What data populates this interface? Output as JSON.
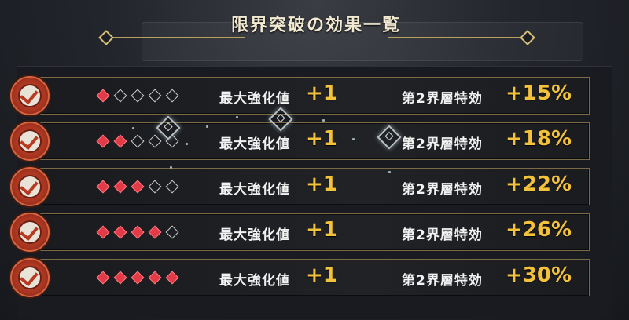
{
  "title": "限界突破の効果一覧",
  "rows": [
    {
      "filled": 1,
      "label1": "最大強化値",
      "val1": "+1",
      "label2": "第2界層特効",
      "val2": "+15%"
    },
    {
      "filled": 2,
      "label1": "最大強化値",
      "val1": "+1",
      "label2": "第2界層特効",
      "val2": "+18%"
    },
    {
      "filled": 3,
      "label1": "最大強化値",
      "val1": "+1",
      "label2": "第2界層特効",
      "val2": "+22%"
    },
    {
      "filled": 4,
      "label1": "最大強化値",
      "val1": "+1",
      "label2": "第2界層特効",
      "val2": "+26%"
    },
    {
      "filled": 5,
      "label1": "最大強化値",
      "val1": "+1",
      "label2": "第2界層特効",
      "val2": "+30%"
    }
  ],
  "icons": {
    "seal": "check-seal-icon",
    "filled": "red-diamond-icon",
    "empty": "outline-diamond-icon"
  },
  "colors": {
    "accent": "#f4c23a",
    "seal": "#b63a22",
    "diamond_on": "#e23a46",
    "frame": "#7a6a46"
  }
}
